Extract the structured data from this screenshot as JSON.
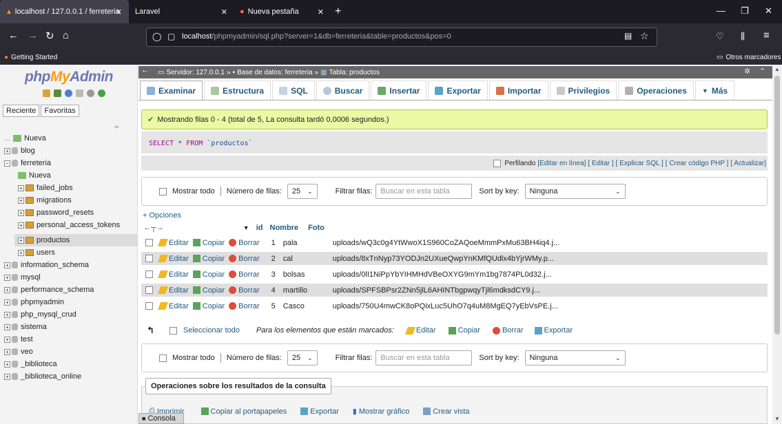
{
  "browser": {
    "tabs": [
      {
        "label": "localhost / 127.0.0.1 / ferreteria"
      },
      {
        "label": "Laravel"
      },
      {
        "label": "Nueva pestaña"
      }
    ],
    "url_host": "localhost",
    "url_path": "/phpmyadmin/sql.php?server=1&db=ferreteria&table=productos&pos=0",
    "bookmark_left": "Getting Started",
    "bookmark_right": "Otros marcadores"
  },
  "sidebar": {
    "logo_php": "php",
    "logo_my": "My",
    "logo_admin": "Admin",
    "tab_recent": "Reciente",
    "tab_fav": "Favoritas",
    "tree": [
      {
        "label": "Nueva",
        "level": 0,
        "type": "new"
      },
      {
        "label": "blog",
        "level": 0,
        "type": "db"
      },
      {
        "label": "ferreteria",
        "level": 0,
        "type": "db"
      },
      {
        "label": "Nueva",
        "level": 1,
        "type": "new"
      },
      {
        "label": "failed_jobs",
        "level": 1,
        "type": "table"
      },
      {
        "label": "migrations",
        "level": 1,
        "type": "table"
      },
      {
        "label": "password_resets",
        "level": 1,
        "type": "table"
      },
      {
        "label": "personal_access_tokens",
        "level": 1,
        "type": "table"
      },
      {
        "label": "productos",
        "level": 1,
        "type": "table"
      },
      {
        "label": "users",
        "level": 1,
        "type": "table"
      },
      {
        "label": "information_schema",
        "level": 0,
        "type": "db"
      },
      {
        "label": "mysql",
        "level": 0,
        "type": "db"
      },
      {
        "label": "performance_schema",
        "level": 0,
        "type": "db"
      },
      {
        "label": "phpmyadmin",
        "level": 0,
        "type": "db"
      },
      {
        "label": "php_mysql_crud",
        "level": 0,
        "type": "db"
      },
      {
        "label": "sistema",
        "level": 0,
        "type": "db"
      },
      {
        "label": "test",
        "level": 0,
        "type": "db"
      },
      {
        "label": "veo",
        "level": 0,
        "type": "db"
      },
      {
        "label": "_biblioteca",
        "level": 0,
        "type": "db"
      },
      {
        "label": "_biblioteca_online",
        "level": 0,
        "type": "db"
      }
    ]
  },
  "breadcrumb": {
    "server": "Servidor: 127.0.0.1",
    "db": "Base de datos: ferreteria",
    "table": "Tabla: productos"
  },
  "tabs": [
    "Examinar",
    "Estructura",
    "SQL",
    "Buscar",
    "Insertar",
    "Exportar",
    "Importar",
    "Privilegios",
    "Operaciones",
    "Más"
  ],
  "message": "Mostrando filas 0 - 4 (total de 5, La consulta tardó 0,0006 segundos.)",
  "sql": {
    "select": "SELECT",
    "star": "*",
    "from": "FROM",
    "table": "`productos`"
  },
  "profiling": {
    "label": "Perfilando",
    "links": [
      "[Editar en línea]",
      "[ Editar ]",
      "[ Explicar SQL ]",
      "[ Crear código PHP ]",
      "[ Actualizar]"
    ]
  },
  "nav": {
    "show_all": "Mostrar todo",
    "rows_label": "Número de filas:",
    "rows_value": "25",
    "filter_label": "Filtrar filas:",
    "filter_placeholder": "Buscar en esta tabla",
    "sort_label": "Sort by key:",
    "sort_value": "Ninguna"
  },
  "options_link": "+ Opciones",
  "columns": [
    "id",
    "Nombre",
    "Foto"
  ],
  "actions": {
    "edit": "Editar",
    "copy": "Copiar",
    "delete": "Borrar"
  },
  "rows": [
    {
      "id": "1",
      "nombre": "pala",
      "foto": "uploads/wQ3c0g4YtWwoX1S960CoZAQoeMmmPxMu63BH4iq4.j..."
    },
    {
      "id": "2",
      "nombre": "cal",
      "foto": "uploads/8xTnNyp73YODJn2UXueQwpYnKMfQUdlx4bYjrWMy.p..."
    },
    {
      "id": "3",
      "nombre": "bolsas",
      "foto": "uploads/0lI1NiPpYbYIHMHdVBeOXYG9mYm1bg7874PL0d32.j..."
    },
    {
      "id": "4",
      "nombre": "martillo",
      "foto": "uploads/SPFSBPsr2ZNn5jlL6AHINTbgpwqyTjl6mdksdCY9.j..."
    },
    {
      "id": "5",
      "nombre": "Casco",
      "foto": "uploads/750U4mwCK8oPQixLuc5UhO7q4uM8MgEQ7yEbVsPE.j..."
    }
  ],
  "bulk": {
    "select_all": "Seleccionar todo",
    "marked_label": "Para los elementos que están marcados:",
    "edit": "Editar",
    "copy": "Copiar",
    "delete": "Borrar",
    "export": "Exportar"
  },
  "ops": {
    "legend": "Operaciones sobre los resultados de la consulta",
    "print": "Imprimir",
    "clipboard": "Copiar al portapapeles",
    "export": "Exportar",
    "chart": "Mostrar gráfico",
    "view": "Crear vista"
  },
  "console": "Consola"
}
